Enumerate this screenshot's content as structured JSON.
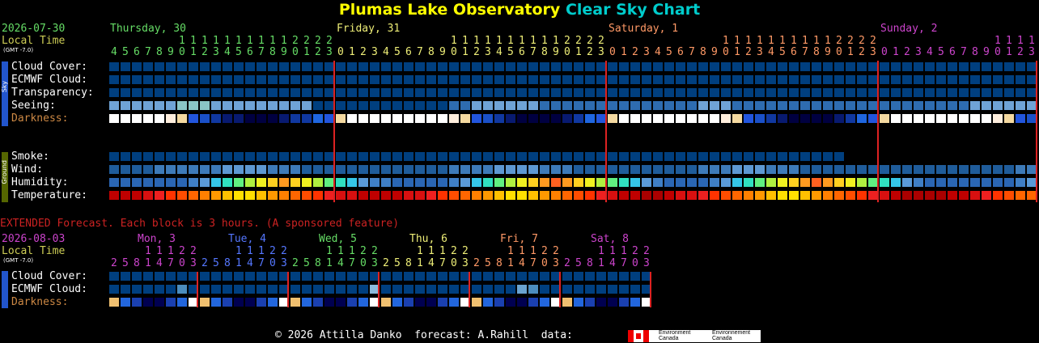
{
  "header": {
    "title_part1": "Plumas Lake Observatory",
    "title_part2": "Clear Sky Chart",
    "date": "2026-07-30",
    "local_time": "Local Time",
    "gmt": "(GMT -7.0)",
    "colors": {
      "title1": "#ffff00",
      "title2": "#00cccc",
      "date": "#66dd66",
      "local_time": "#cccc55"
    }
  },
  "days": [
    {
      "label": "Thursday, 30",
      "color": "#66dd66"
    },
    {
      "label": "Friday, 31",
      "color": "#eeee77"
    },
    {
      "label": "Saturday, 1",
      "color": "#ff9966"
    },
    {
      "label": "Sunday, 2",
      "color": "#cc44cc"
    }
  ],
  "sky_group_label": "Sky",
  "ground_group_label": "Ground",
  "sky_rows": [
    {
      "label": "Cloud Cover:",
      "color": "#ffffff"
    },
    {
      "label": "ECMWF Cloud:",
      "color": "#ffffff"
    },
    {
      "label": "Transparency:",
      "color": "#ffffff"
    },
    {
      "label": "Seeing:",
      "color": "#ffffff"
    },
    {
      "label": "Darkness:",
      "color": "#cc8844"
    }
  ],
  "ground_rows": [
    {
      "label": "Smoke:"
    },
    {
      "label": "Wind:"
    },
    {
      "label": "Humidity:"
    },
    {
      "label": "Temperature:"
    }
  ],
  "chart_data": {
    "type": "heatmap",
    "first_hour": 4,
    "hours": 82,
    "midnight_hours": [
      20,
      44,
      68
    ],
    "cloud_cover": [
      0,
      0,
      0,
      0,
      0,
      0,
      0,
      0,
      0,
      0,
      0,
      0,
      0,
      0,
      0,
      0,
      0,
      0,
      0,
      0,
      0,
      0,
      0,
      0,
      0,
      0,
      0,
      0,
      0,
      0,
      0,
      0,
      0,
      0,
      0,
      0,
      0,
      0,
      0,
      0,
      0,
      0,
      0,
      0,
      0,
      0,
      0,
      0,
      0,
      0,
      0,
      0,
      0,
      0,
      0,
      0,
      0,
      0,
      0,
      0,
      0,
      0,
      0,
      0,
      0,
      0,
      0,
      0,
      0,
      0,
      0,
      0,
      0,
      0,
      0,
      0,
      0,
      0,
      0,
      0,
      0,
      0
    ],
    "ecmwf_cloud": [
      0,
      0,
      0,
      0,
      0,
      0,
      0,
      0,
      0,
      0,
      0,
      0,
      0,
      0,
      0,
      0,
      0,
      0,
      0,
      0,
      0,
      0,
      0,
      0,
      0,
      0,
      0,
      0,
      0,
      0,
      0,
      0,
      0,
      0,
      0,
      0,
      0,
      0,
      0,
      0,
      0,
      0,
      0,
      0,
      0,
      0,
      0,
      0,
      0,
      0,
      0,
      0,
      0,
      0,
      0,
      0,
      0,
      0,
      0,
      0,
      0,
      0,
      0,
      0,
      0,
      0,
      0,
      0,
      0,
      0,
      0,
      0,
      0,
      0,
      0,
      0,
      0,
      0,
      0,
      0,
      0,
      0
    ],
    "transparency": [
      5,
      5,
      5,
      5,
      5,
      5,
      5,
      5,
      5,
      5,
      5,
      5,
      5,
      5,
      5,
      5,
      5,
      5,
      5,
      5,
      5,
      5,
      5,
      5,
      5,
      5,
      5,
      5,
      5,
      5,
      5,
      5,
      5,
      5,
      5,
      5,
      5,
      5,
      5,
      5,
      5,
      5,
      5,
      5,
      5,
      5,
      5,
      5,
      5,
      5,
      5,
      5,
      5,
      5,
      5,
      5,
      5,
      5,
      5,
      5,
      5,
      5,
      5,
      5,
      5,
      5,
      5,
      5,
      5,
      5,
      5,
      5,
      5,
      5,
      5,
      5,
      5,
      5,
      5,
      5,
      5,
      5
    ],
    "seeing": [
      2,
      2,
      2,
      2,
      2,
      2,
      1,
      1,
      1,
      2,
      2,
      2,
      2,
      2,
      2,
      2,
      2,
      2,
      4,
      4,
      4,
      4,
      4,
      4,
      4,
      4,
      4,
      4,
      4,
      4,
      3,
      3,
      2,
      2,
      2,
      2,
      2,
      2,
      3,
      3,
      3,
      3,
      3,
      3,
      3,
      3,
      3,
      3,
      3,
      3,
      3,
      3,
      2,
      2,
      2,
      3,
      3,
      3,
      3,
      3,
      3,
      3,
      3,
      3,
      3,
      3,
      3,
      3,
      3,
      3,
      3,
      3,
      3,
      3,
      3,
      3,
      2,
      2,
      2,
      2,
      2,
      2
    ],
    "darkness": [
      -4,
      -4,
      -4,
      -4,
      -4,
      -3,
      -2,
      0,
      2,
      3,
      4,
      4,
      5,
      5,
      5,
      4,
      3,
      3,
      1,
      0,
      -2,
      -4,
      -4,
      -4,
      -4,
      -4,
      -4,
      -4,
      -4,
      -4,
      -3,
      -2,
      0,
      2,
      3,
      4,
      5,
      5,
      5,
      5,
      4,
      3,
      1,
      0,
      -2,
      -4,
      -4,
      -4,
      -4,
      -4,
      -4,
      -4,
      -4,
      -4,
      -3,
      -2,
      0,
      2,
      3,
      4,
      5,
      5,
      5,
      5,
      4,
      3,
      1,
      0,
      -2,
      -4,
      -4,
      -4,
      -4,
      -4,
      -4,
      -4,
      -4,
      -4,
      -3,
      -2,
      0,
      2
    ],
    "smoke": [
      0,
      0,
      0,
      0,
      0,
      0,
      0,
      0,
      0,
      0,
      0,
      0,
      0,
      0,
      0,
      0,
      0,
      0,
      0,
      0,
      0,
      0,
      0,
      0,
      0,
      0,
      0,
      0,
      0,
      0,
      0,
      0,
      0,
      0,
      0,
      0,
      0,
      0,
      0,
      0,
      0,
      0,
      0,
      0,
      0,
      0,
      0,
      0,
      0,
      0,
      0,
      0,
      0,
      0,
      0,
      0,
      0,
      0,
      0,
      0,
      0,
      0,
      0,
      0,
      0
    ],
    "wind": [
      1,
      1,
      1,
      1,
      2,
      2,
      2,
      2,
      2,
      2,
      3,
      3,
      3,
      3,
      2,
      2,
      2,
      1,
      1,
      1,
      1,
      1,
      1,
      1,
      1,
      1,
      1,
      1,
      1,
      1,
      2,
      2,
      2,
      2,
      3,
      3,
      3,
      3,
      2,
      2,
      2,
      1,
      1,
      1,
      1,
      1,
      1,
      1,
      1,
      1,
      1,
      1,
      2,
      2,
      2,
      3,
      3,
      3,
      2,
      2,
      2,
      1,
      1,
      1,
      1,
      1,
      1,
      1,
      1,
      1,
      1,
      1,
      1,
      1,
      1,
      1,
      1,
      1,
      1,
      1,
      2,
      2
    ],
    "humidity": [
      3,
      3,
      3,
      3,
      3,
      3,
      3,
      4,
      5,
      6,
      7,
      8,
      9,
      10,
      11,
      12,
      11,
      10,
      9,
      8,
      7,
      6,
      5,
      4,
      4,
      3,
      3,
      3,
      3,
      3,
      4,
      5,
      6,
      7,
      8,
      9,
      10,
      11,
      12,
      13,
      12,
      11,
      10,
      9,
      8,
      7,
      6,
      5,
      4,
      3,
      3,
      3,
      3,
      4,
      5,
      6,
      7,
      8,
      9,
      10,
      11,
      12,
      13,
      12,
      11,
      10,
      9,
      8,
      7,
      6,
      5,
      4,
      3,
      3,
      3,
      3,
      3,
      3,
      3,
      3,
      4,
      5
    ],
    "temperature": [
      14,
      14,
      14,
      15,
      16,
      17,
      18,
      19,
      20,
      21,
      22,
      23,
      23,
      22,
      21,
      20,
      19,
      18,
      17,
      16,
      15,
      15,
      14,
      14,
      14,
      14,
      15,
      15,
      16,
      17,
      18,
      19,
      20,
      21,
      22,
      23,
      23,
      22,
      21,
      20,
      19,
      18,
      17,
      16,
      15,
      14,
      14,
      13,
      13,
      14,
      15,
      15,
      16,
      17,
      18,
      19,
      20,
      21,
      22,
      23,
      23,
      22,
      21,
      20,
      19,
      18,
      17,
      16,
      15,
      14,
      13,
      13,
      13,
      13,
      14,
      14,
      15,
      16,
      17,
      18,
      19,
      19
    ]
  },
  "extended": {
    "heading": "EXTENDED Forecast. Each block is 3 hours. (A sponsored feature)",
    "date": "2026-08-03",
    "local_time": "Local Time",
    "gmt": "(GMT -7.0)",
    "days": [
      {
        "label": "Mon, 3",
        "color": "#cc44cc"
      },
      {
        "label": "Tue, 4",
        "color": "#5577ff"
      },
      {
        "label": "Wed, 5",
        "color": "#66dd66"
      },
      {
        "label": "Thu, 6",
        "color": "#eeee77"
      },
      {
        "label": "Fri, 7",
        "color": "#ff9966"
      },
      {
        "label": "Sat, 8",
        "color": "#cc44cc"
      }
    ],
    "hours": [
      2,
      5,
      8,
      11,
      14,
      17,
      20,
      23
    ],
    "rows": [
      {
        "label": "Cloud Cover:",
        "color": "#ffffff"
      },
      {
        "label": "ECMWF Cloud:",
        "color": "#ffffff"
      },
      {
        "label": "Darkness:",
        "color": "#cc8844"
      }
    ],
    "cloud_cover": [
      0,
      0,
      0,
      0,
      0,
      0,
      0,
      0,
      0,
      0,
      0,
      0,
      0,
      0,
      0,
      0,
      0,
      0,
      0,
      0,
      0,
      0,
      0,
      0,
      0,
      0,
      0,
      0,
      0,
      0,
      0,
      0,
      0,
      0,
      0,
      0,
      0,
      0,
      0,
      0,
      0,
      0,
      0,
      0,
      0,
      0,
      0,
      0
    ],
    "ecmwf_cloud": [
      0,
      0,
      0,
      0,
      0,
      0,
      1,
      0,
      0,
      0,
      0,
      0,
      0,
      0,
      0,
      0,
      0,
      0,
      0,
      0,
      0,
      0,
      0,
      3,
      0,
      0,
      0,
      0,
      0,
      0,
      0,
      0,
      0,
      0,
      0,
      0,
      2,
      1,
      0,
      0,
      0,
      0,
      0,
      0,
      0,
      0,
      0,
      0
    ]
  },
  "footer": {
    "text": "© 2026 Attilla Danko  forecast: A.Rahill  data:",
    "logo1": "Environment Canada",
    "logo2": "Environnement Canada"
  }
}
